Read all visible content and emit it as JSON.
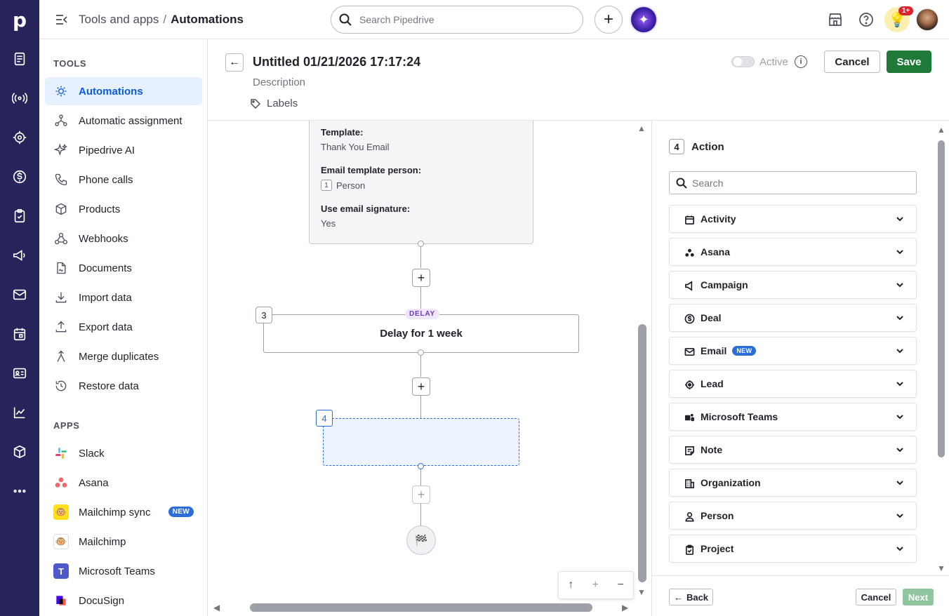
{
  "topbar": {
    "crumb_parent": "Tools and apps",
    "crumb_sep": "/",
    "crumb_current": "Automations",
    "search_placeholder": "Search Pipedrive",
    "add_label": "+",
    "notification_count": "1+"
  },
  "sidenav": {
    "tools_title": "TOOLS",
    "tools": [
      {
        "label": "Automations",
        "icon": "automations-icon",
        "active": true
      },
      {
        "label": "Automatic assignment",
        "icon": "assignment-icon"
      },
      {
        "label": "Pipedrive AI",
        "icon": "sparkle-icon"
      },
      {
        "label": "Phone calls",
        "icon": "phone-icon"
      },
      {
        "label": "Products",
        "icon": "box-icon"
      },
      {
        "label": "Webhooks",
        "icon": "webhook-icon"
      },
      {
        "label": "Documents",
        "icon": "document-icon"
      },
      {
        "label": "Import data",
        "icon": "download-icon"
      },
      {
        "label": "Export data",
        "icon": "upload-icon"
      },
      {
        "label": "Merge duplicates",
        "icon": "merge-icon"
      },
      {
        "label": "Restore data",
        "icon": "restore-icon"
      }
    ],
    "apps_title": "APPS",
    "apps": [
      {
        "label": "Slack",
        "icon": "slack-icon"
      },
      {
        "label": "Asana",
        "icon": "asana-icon"
      },
      {
        "label": "Mailchimp sync",
        "icon": "mailchimp-sync-icon",
        "badge": "NEW"
      },
      {
        "label": "Mailchimp",
        "icon": "mailchimp-icon"
      },
      {
        "label": "Microsoft Teams",
        "icon": "teams-icon"
      },
      {
        "label": "DocuSign",
        "icon": "docusign-icon"
      }
    ]
  },
  "header": {
    "title": "Untitled 01/21/2026 17:17:24",
    "description": "Description",
    "labels": "Labels",
    "active_label": "Active",
    "cancel": "Cancel",
    "save": "Save"
  },
  "canvas": {
    "email_card": {
      "template_key": "Template:",
      "template_value": "Thank You Email",
      "person_key": "Email template person:",
      "person_num": "1",
      "person_value": "Person",
      "signature_key": "Use email signature:",
      "signature_value": "Yes"
    },
    "step3_num": "3",
    "delay_pill": "DELAY",
    "delay_text": "Delay for 1 week",
    "step4_num": "4"
  },
  "panel": {
    "step_num": "4",
    "title": "Action",
    "search_placeholder": "Search",
    "categories": [
      {
        "label": "Activity",
        "icon": "calendar-icon"
      },
      {
        "label": "Asana",
        "icon": "asana-dots-icon"
      },
      {
        "label": "Campaign",
        "icon": "megaphone-icon"
      },
      {
        "label": "Deal",
        "icon": "dollar-icon"
      },
      {
        "label": "Email",
        "icon": "mail-icon",
        "badge": "NEW"
      },
      {
        "label": "Lead",
        "icon": "target-icon"
      },
      {
        "label": "Microsoft Teams",
        "icon": "teams-icon"
      },
      {
        "label": "Note",
        "icon": "note-icon"
      },
      {
        "label": "Organization",
        "icon": "building-icon"
      },
      {
        "label": "Person",
        "icon": "person-icon"
      },
      {
        "label": "Project",
        "icon": "clipboard-icon"
      }
    ],
    "back": "Back",
    "cancel": "Cancel",
    "next": "Next"
  },
  "colors": {
    "rail": "#26245a",
    "accent_blue": "#0b5cd9",
    "save_green": "#1f7a3a",
    "next_disabled": "#8fc59f"
  }
}
